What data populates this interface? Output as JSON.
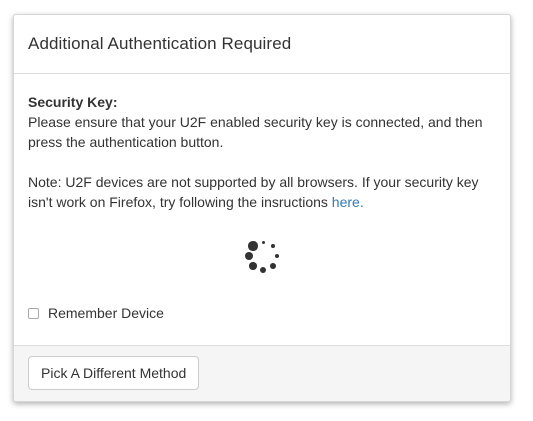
{
  "panel": {
    "title": "Additional Authentication Required"
  },
  "body": {
    "security_key_label": "Security Key:",
    "instructions": "Please ensure that your U2F enabled security key is connected, and then press the authentication button.",
    "note_text": "Note: U2F devices are not supported by all browsers. If your security key isn't work on Firefox, try following the insructions ",
    "note_link": "here."
  },
  "spinner": {
    "icon": "loading-spinner-icon",
    "color": "#333333"
  },
  "remember": {
    "label": "Remember Device",
    "checked": false
  },
  "footer": {
    "button_label": "Pick A Different Method"
  },
  "colors": {
    "link": "#337ab7",
    "footer_bg": "#f5f5f5",
    "text": "#333333"
  }
}
